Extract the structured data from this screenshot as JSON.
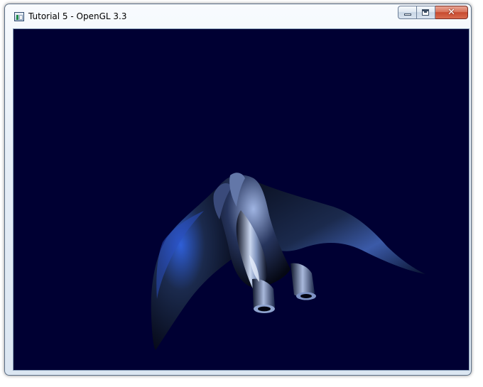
{
  "window": {
    "title": "Tutorial 5 - OpenGL 3.3",
    "icon": "application-window-icon",
    "controls": {
      "minimize": "minimize-icon",
      "maximize": "maximize-icon",
      "close": "close-icon",
      "close_glyph": "✕"
    }
  },
  "viewport": {
    "clear_color": "#000033",
    "scene": "3d-spaceship-model",
    "model_colors": {
      "shadow": "#02030f",
      "body": "#1b2a4d",
      "highlight": "#2f5fd8",
      "specular": "#c9d6ee"
    }
  }
}
